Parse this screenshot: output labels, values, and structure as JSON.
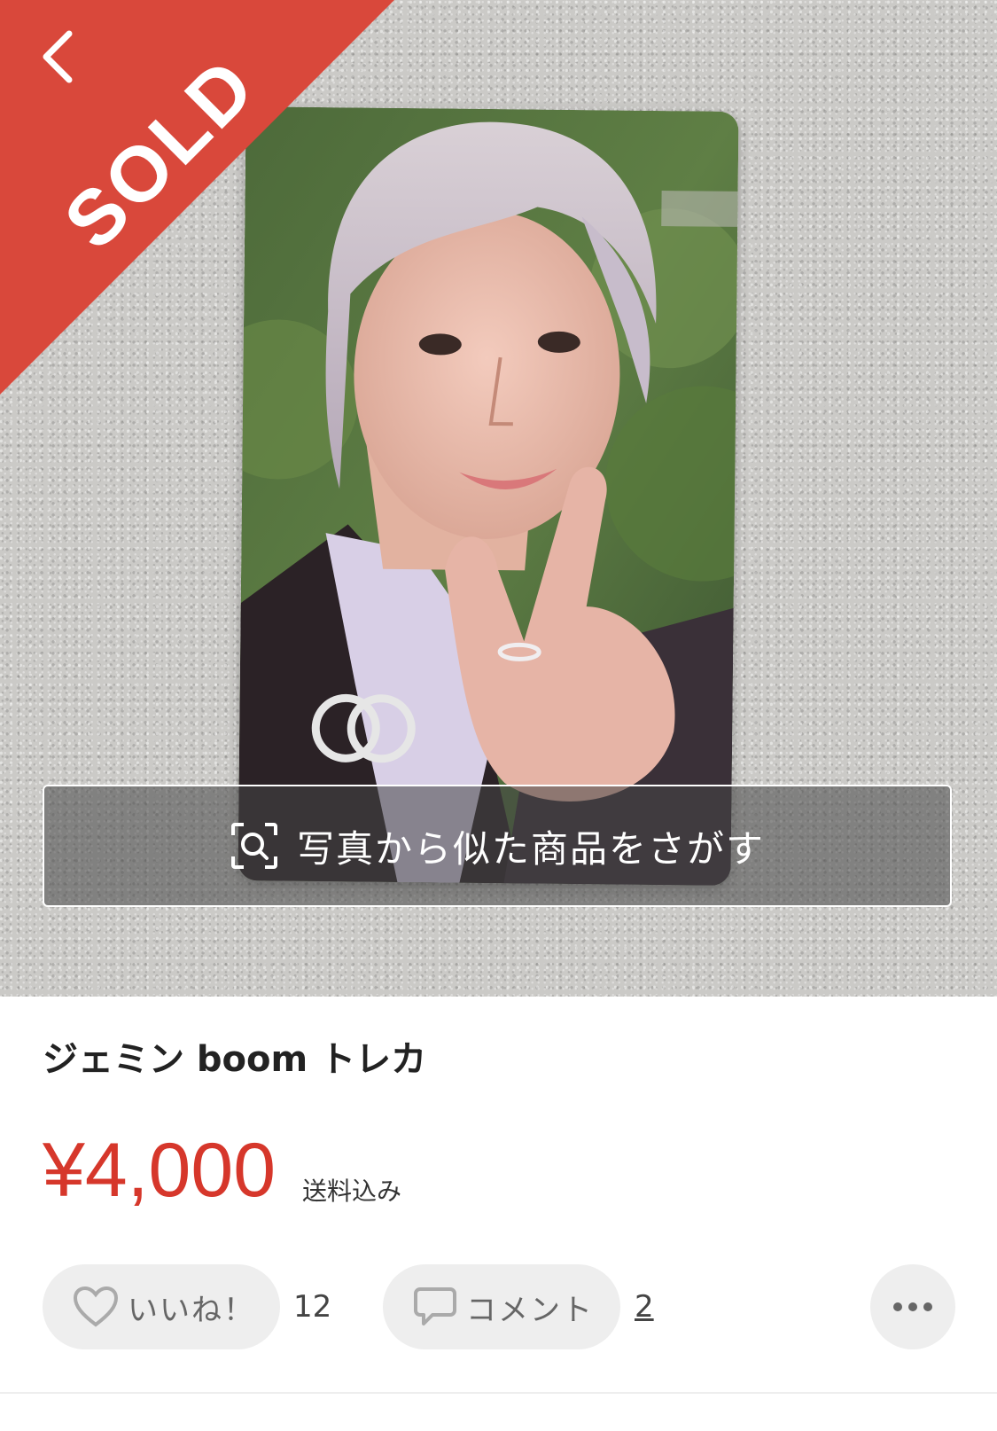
{
  "status_badge": "SOLD",
  "photo_search": {
    "label": "写真から似た商品をさがす"
  },
  "item": {
    "title": "ジェミン boom トレカ",
    "price": "¥4,000",
    "shipping_note": "送料込み"
  },
  "actions": {
    "like_label": "いいね！",
    "like_count": "12",
    "comment_label": "コメント",
    "comment_count": "2"
  },
  "colors": {
    "sold_ribbon": "#d9483b",
    "price": "#d6372b",
    "pill_bg": "#eeeeee"
  }
}
